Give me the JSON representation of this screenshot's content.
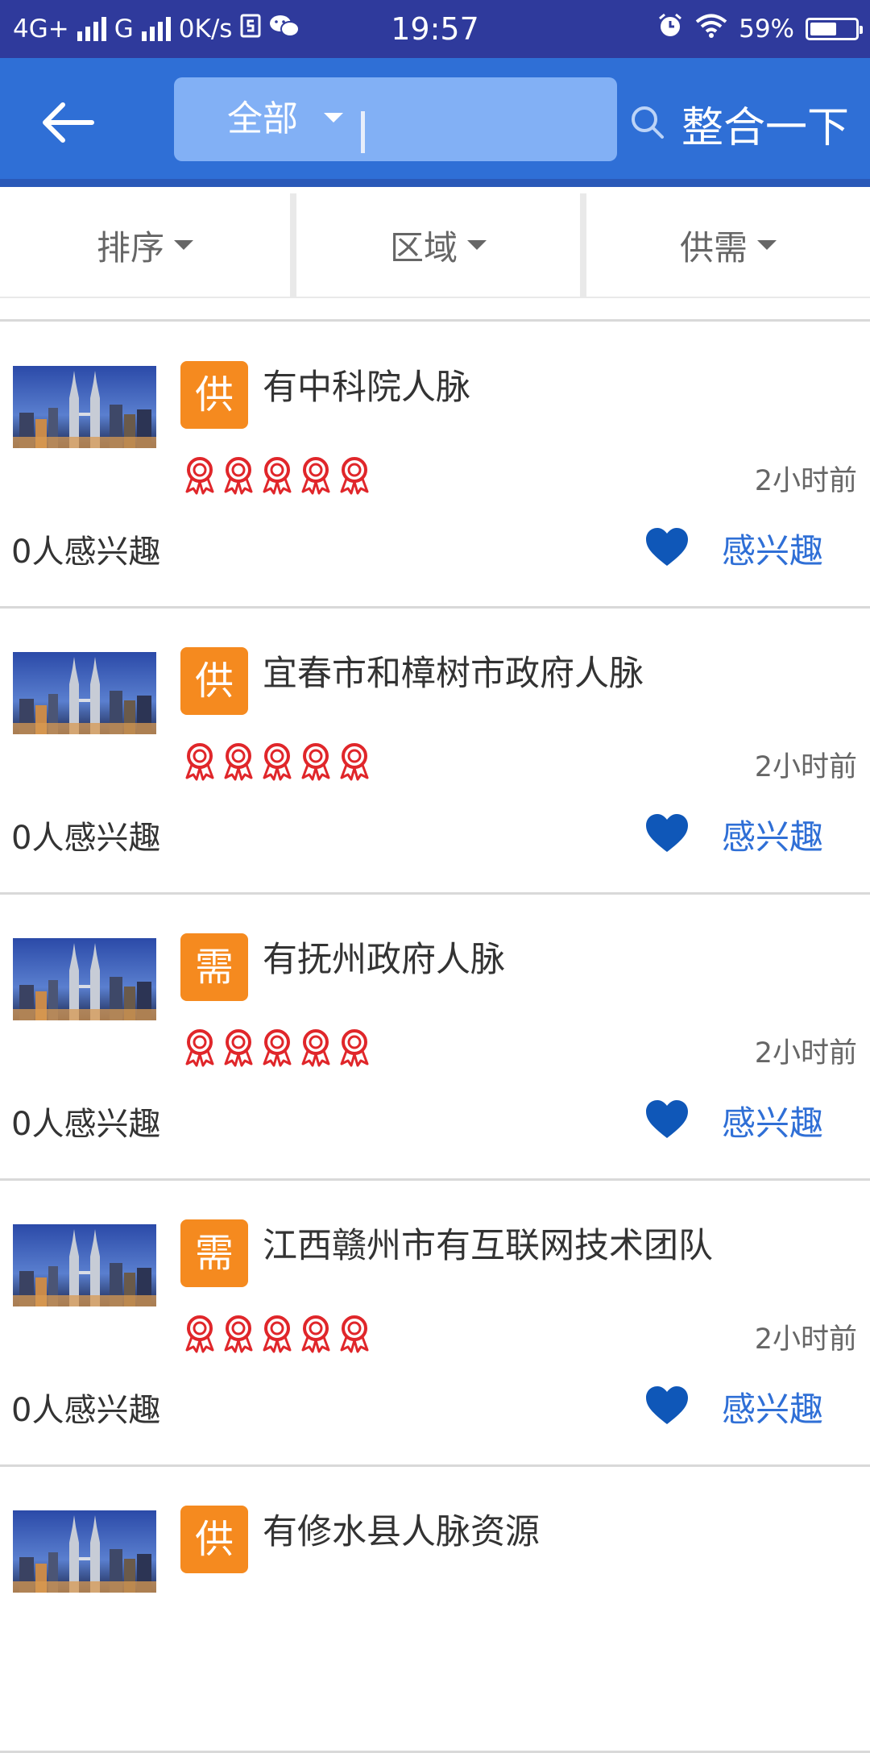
{
  "status_bar": {
    "network_1": "4G+",
    "network_2": "G",
    "speed": "0K/s",
    "time": "19:57",
    "battery_text": "59%",
    "battery_level": 59
  },
  "header": {
    "scope_label": "全部",
    "search_button": "整合一下"
  },
  "filters": [
    {
      "label": "排序"
    },
    {
      "label": "区域"
    },
    {
      "label": "供需"
    }
  ],
  "items": [
    {
      "badge": "供",
      "title": "有中科院人脉",
      "time": "2小时前",
      "interest_count": "0人感兴趣",
      "interest_label": "感兴趣",
      "rating": 5
    },
    {
      "badge": "供",
      "title": "宜春市和樟树市政府人脉",
      "time": "2小时前",
      "interest_count": "0人感兴趣",
      "interest_label": "感兴趣",
      "rating": 5
    },
    {
      "badge": "需",
      "title": "有抚州政府人脉",
      "time": "2小时前",
      "interest_count": "0人感兴趣",
      "interest_label": "感兴趣",
      "rating": 5
    },
    {
      "badge": "需",
      "title": "江西赣州市有互联网技术团队",
      "time": "2小时前",
      "interest_count": "0人感兴趣",
      "interest_label": "感兴趣",
      "rating": 5
    },
    {
      "badge": "供",
      "title": "有修水县人脉资源",
      "time": "",
      "interest_count": "",
      "interest_label": "",
      "rating": 0
    }
  ],
  "colors": {
    "status_bar": "#2f3a9c",
    "header": "#2f6fd6",
    "badge": "#f58a1f",
    "medal": "#e0262a",
    "heart": "#0f57b8"
  }
}
